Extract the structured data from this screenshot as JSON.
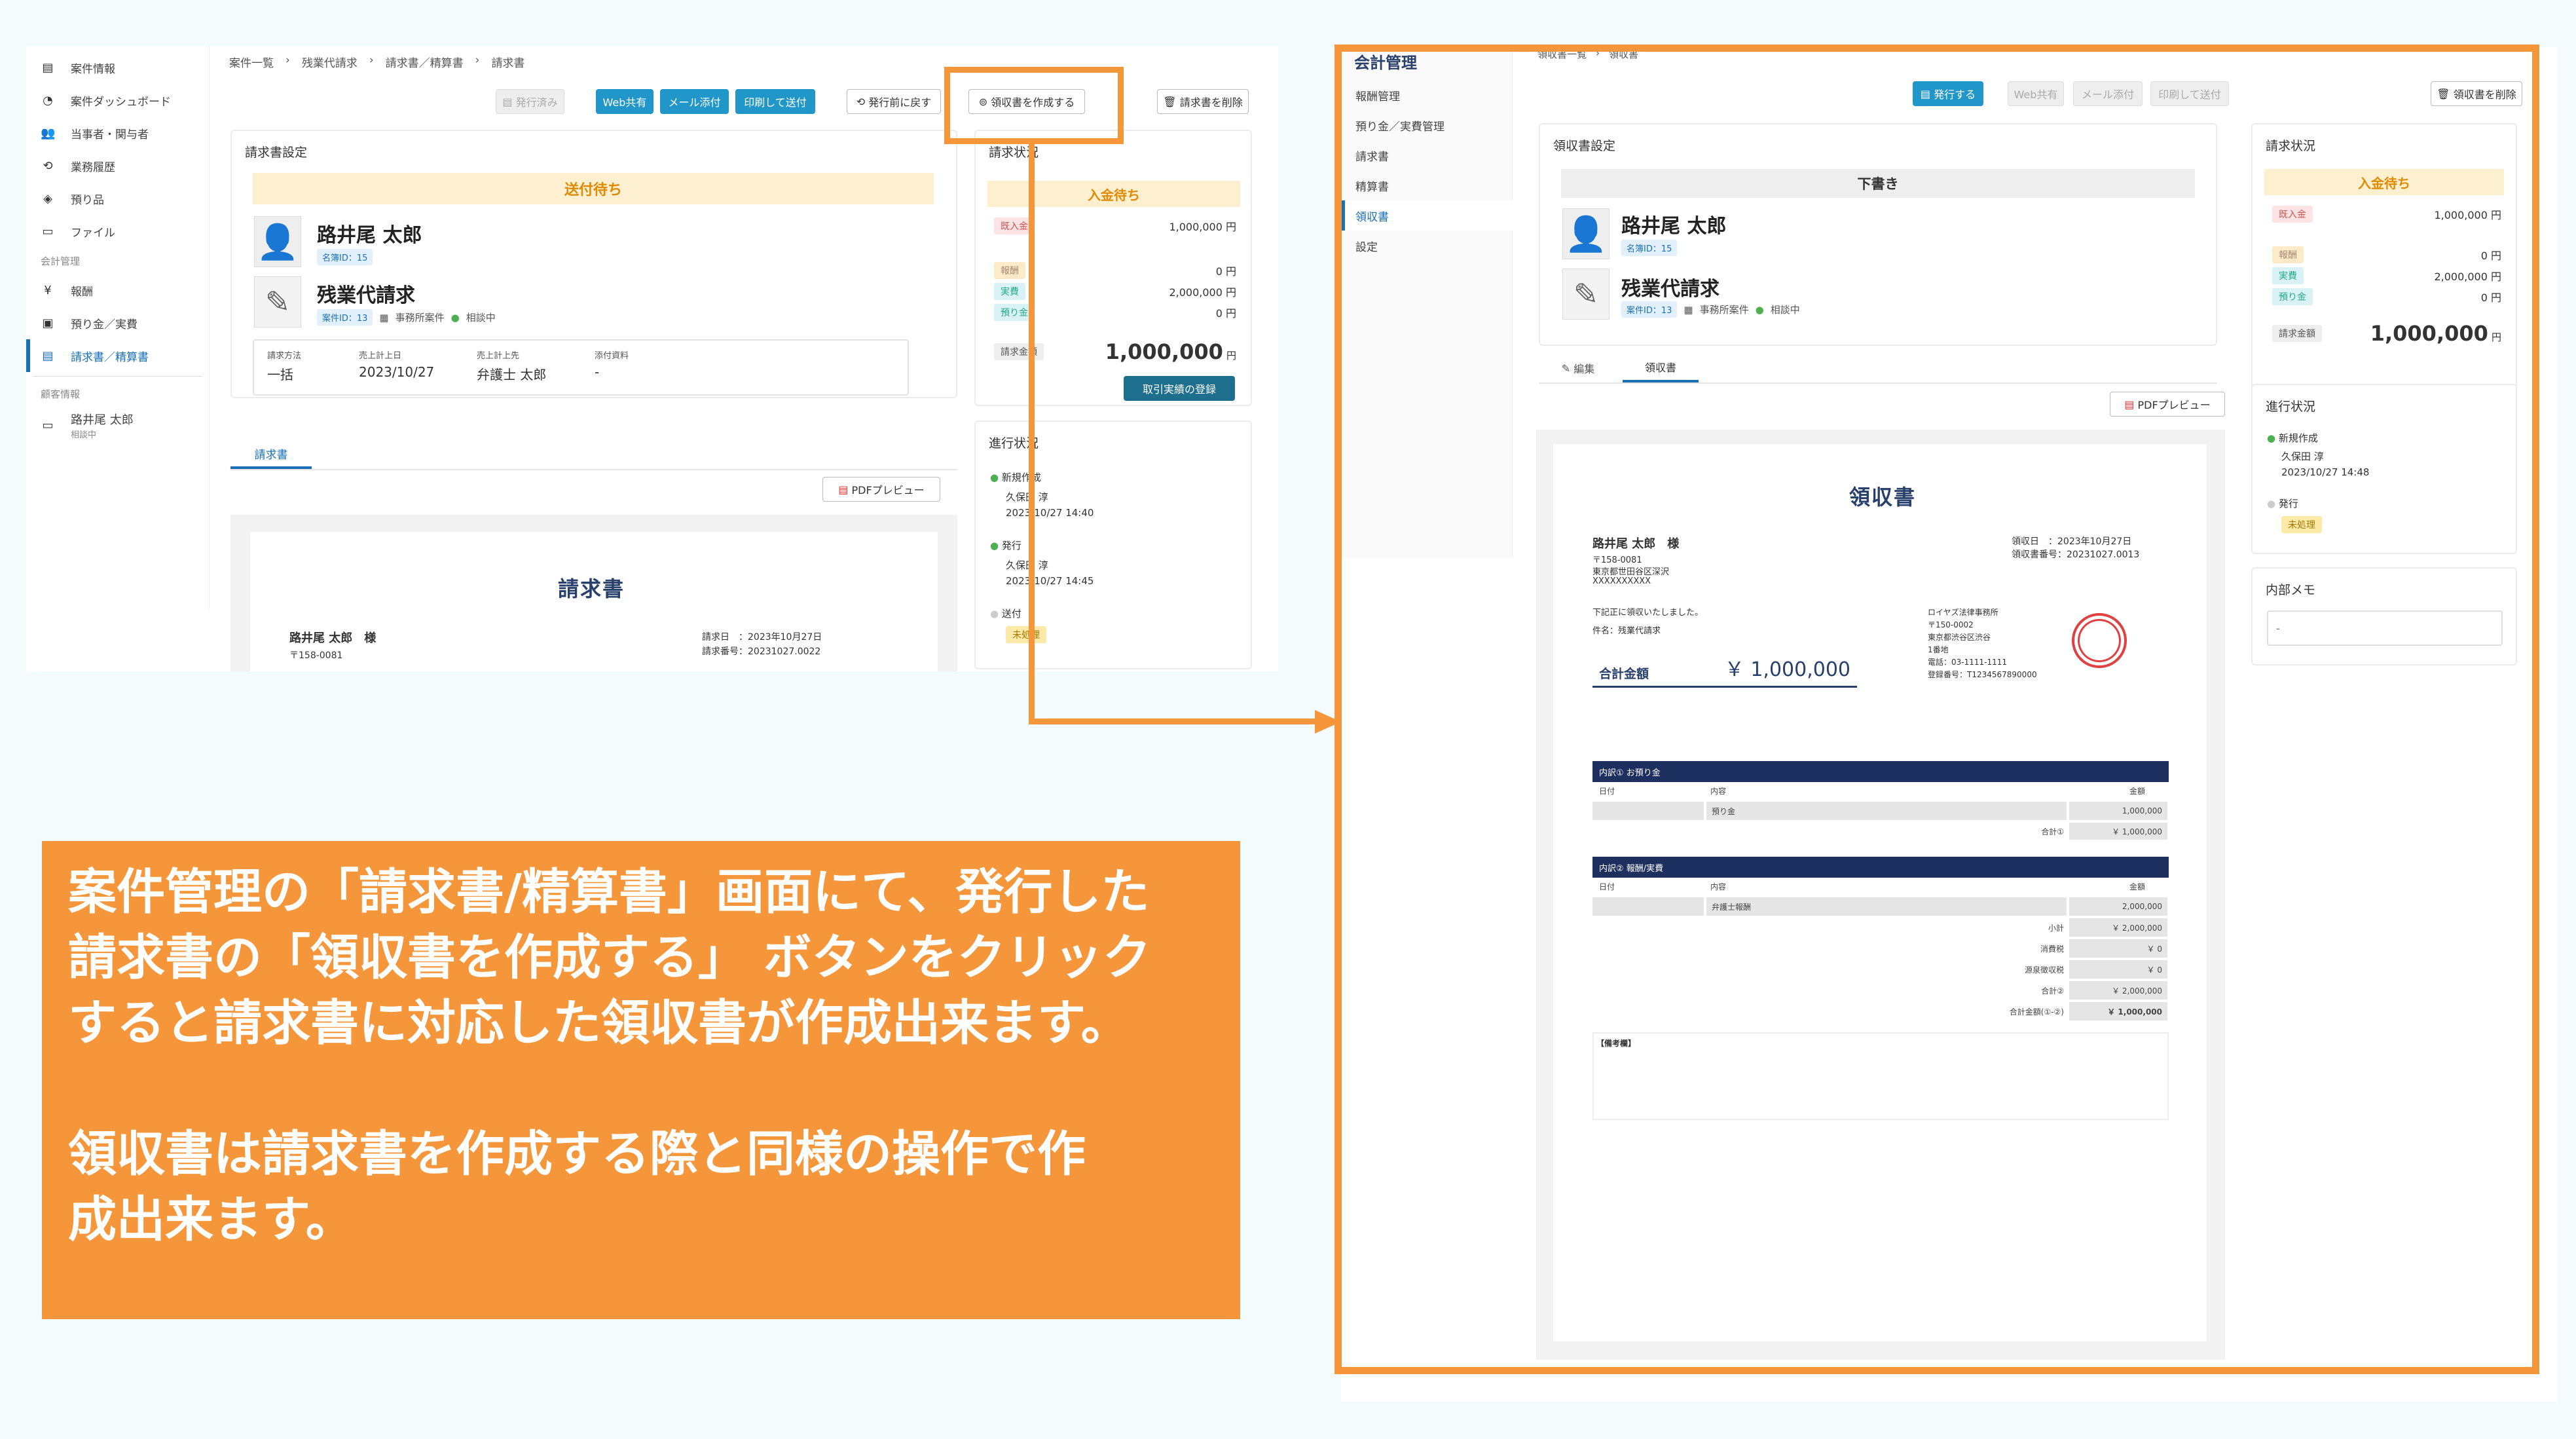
{
  "left_window": {
    "sidebar": {
      "items": [
        {
          "icon": "document-icon",
          "glyph": "▤",
          "label": "案件情報"
        },
        {
          "icon": "dashboard-icon",
          "glyph": "◔",
          "label": "案件ダッシュボード"
        },
        {
          "icon": "people-icon",
          "glyph": "👥",
          "label": "当事者・関与者"
        },
        {
          "icon": "history-icon",
          "glyph": "⟲",
          "label": "業務履歴"
        },
        {
          "icon": "box-icon",
          "glyph": "◈",
          "label": "預り品"
        },
        {
          "icon": "folder-icon",
          "glyph": "▭",
          "label": "ファイル"
        }
      ],
      "section_accounting": "会計管理",
      "accounting_items": [
        {
          "icon": "yen-icon",
          "glyph": "¥",
          "label": "報酬"
        },
        {
          "icon": "deposit-icon",
          "glyph": "▣",
          "label": "預り金／実費"
        },
        {
          "icon": "invoice-icon",
          "glyph": "▤",
          "label": "請求書／精算書"
        }
      ],
      "section_client": "顧客情報",
      "client_name": "路井尾 太郎",
      "client_status": "相談中"
    },
    "breadcrumb": [
      "案件一覧",
      "残業代請求",
      "請求書／精算書",
      "請求書"
    ],
    "toolbar": {
      "issued": "発行済み",
      "web_share": "Web共有",
      "mail_attach": "メール添付",
      "print_send": "印刷して送付",
      "revert": "発行前に戻す",
      "create_receipt": "領収書を作成する",
      "delete_invoice": "請求書を削除"
    },
    "invoice_settings": {
      "title": "請求書設定",
      "status": "送付待ち",
      "person_name": "路井尾 太郎",
      "person_tag": "名簿ID：15",
      "case_name": "残業代請求",
      "case_tag": "案件ID：13",
      "case_type": "事務所案件",
      "case_status": "相談中",
      "fields": [
        {
          "label": "請求方法",
          "value": "一括"
        },
        {
          "label": "売上計上日",
          "value": "2023/10/27"
        },
        {
          "label": "売上計上先",
          "value": "弁護士 太郎"
        },
        {
          "label": "添付資料",
          "value": "-"
        }
      ]
    },
    "invoice_status": {
      "title": "請求状況",
      "status": "入金待ち",
      "received_label": "既入金",
      "received_value": "1,000,000 円",
      "lines": [
        {
          "label": "報酬",
          "value": "0 円"
        },
        {
          "label": "実費",
          "value": "2,000,000 円"
        },
        {
          "label": "預り金",
          "value": "0 円"
        }
      ],
      "total_label": "請求金額",
      "total_value": "1,000,000",
      "total_unit": "円",
      "register_button": "取引実績の登録"
    },
    "progress": {
      "title": "進行状況",
      "steps": [
        {
          "label": "新規作成",
          "person": "久保田 淳",
          "time": "2023/10/27 14:40"
        },
        {
          "label": "発行",
          "person": "久保田 淳",
          "time": "2023/10/27 14:45"
        },
        {
          "label": "送付",
          "badge": "未処理"
        }
      ]
    },
    "tab": "請求書",
    "pdf_preview": "PDFプレビュー",
    "doc": {
      "title": "請求書",
      "addressee": "路井尾 太郎　様",
      "zip": "〒158-0081",
      "date_line": "請求日　：2023年10月27日",
      "number_line": "請求番号：20231027.0022"
    }
  },
  "right_window": {
    "sidebar": {
      "title": "会計管理",
      "items": [
        "報酬管理",
        "預り金／実費管理",
        "請求書",
        "精算書",
        "領収書",
        "設定"
      ],
      "active": "領収書"
    },
    "breadcrumb": [
      "領収書一覧",
      "領収書"
    ],
    "toolbar": {
      "issue": "発行する",
      "web_share": "Web共有",
      "mail_attach": "メール添付",
      "print_send": "印刷して送付",
      "delete_receipt": "領収書を削除"
    },
    "receipt_settings": {
      "title": "領収書設定",
      "status": "下書き",
      "person_name": "路井尾 太郎",
      "person_tag": "名簿ID：15",
      "case_name": "残業代請求",
      "case_tag": "案件ID：13",
      "case_type": "事務所案件",
      "case_status": "相談中"
    },
    "invoice_status": {
      "title": "請求状況",
      "status": "入金待ち",
      "received_label": "既入金",
      "received_value": "1,000,000 円",
      "lines": [
        {
          "label": "報酬",
          "value": "0 円"
        },
        {
          "label": "実費",
          "value": "2,000,000 円"
        },
        {
          "label": "預り金",
          "value": "0 円"
        }
      ],
      "total_label": "請求金額",
      "total_value": "1,000,000",
      "total_unit": "円"
    },
    "progress": {
      "title": "進行状況",
      "steps": [
        {
          "label": "新規作成",
          "person": "久保田 淳",
          "time": "2023/10/27 14:48"
        },
        {
          "label": "発行",
          "badge": "未処理"
        }
      ]
    },
    "memo": {
      "title": "内部メモ",
      "placeholder": "-"
    },
    "tabs": [
      "編集",
      "領収書"
    ],
    "pdf_preview": "PDFプレビュー",
    "doc": {
      "title": "領収書",
      "addressee": "路井尾 太郎　様",
      "addr1": "〒158-0081",
      "addr2": "東京都世田谷区深沢",
      "addr3": "XXXXXXXXXX",
      "date_line": "領収日　：2023年10月27日",
      "number_line": "領収書番号：20231027.0013",
      "received_text": "下記正に領収いたしました。",
      "subject": "件名：残業代請求",
      "total_label": "合計金額",
      "total_value": "￥ 1,000,000",
      "office_name": "ロイヤズ法律事務所",
      "office_zip": "〒150-0002",
      "office_addr": "東京都渋谷区渋谷",
      "office_addr2": "1番地",
      "office_tel": "電話：03-1111-1111",
      "office_reg": "登録番号：T1234567890000",
      "section1_title": "内訳① お預り金",
      "section1_cols": [
        "日付",
        "内容",
        "金額"
      ],
      "section1_rows": [
        {
          "date": "",
          "desc": "預り金",
          "amount": "1,000,000"
        }
      ],
      "section1_subtotal_label": "合計①",
      "section1_subtotal": "￥ 1,000,000",
      "section2_title": "内訳② 報酬/実費",
      "section2_cols": [
        "日付",
        "内容",
        "金額"
      ],
      "section2_rows": [
        {
          "date": "",
          "desc": "弁護士報酬",
          "amount": "2,000,000"
        }
      ],
      "section2_sums": [
        {
          "label": "小計",
          "value": "￥ 2,000,000"
        },
        {
          "label": "消費税",
          "value": "￥ 0"
        },
        {
          "label": "源泉徴収税",
          "value": "￥ 0"
        },
        {
          "label": "合計②",
          "value": "￥ 2,000,000"
        },
        {
          "label": "合計金額(①-②)",
          "value": "￥ 1,000,000"
        }
      ],
      "remarks_label": "【備考欄】"
    }
  },
  "callout": {
    "line1": "案件管理の「請求書/精算書」画面にて、発行した",
    "line2": "請求書の「領収書を作成する」 ボタンをクリック",
    "line3": "すると請求書に対応した領収書が作成出来ます。",
    "line4": "領収書は請求書を作成する際と同様の操作で作",
    "line5": "成出来ます。"
  },
  "colors": {
    "highlight_orange": "#f5963a",
    "callout_bg": "#f5963a",
    "primary_blue": "#2196c9",
    "dark_navy": "#1c2f5e"
  }
}
